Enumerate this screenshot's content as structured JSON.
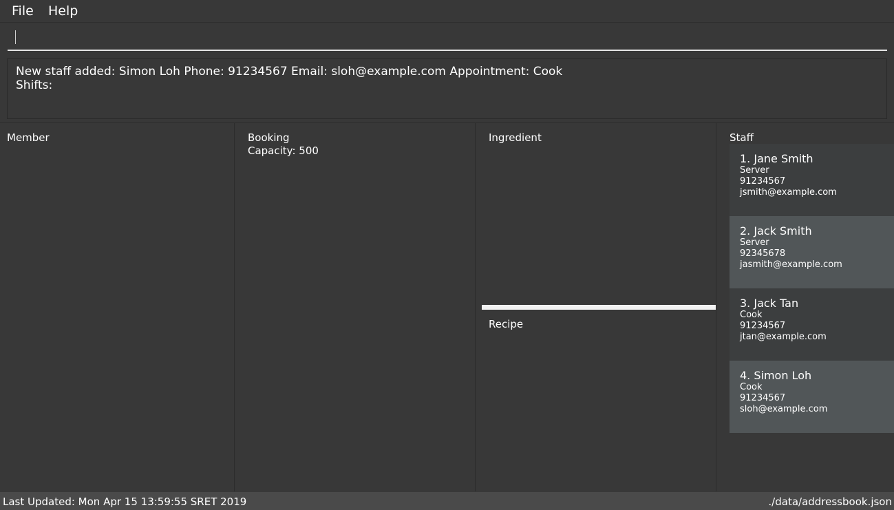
{
  "menu": {
    "file": "File",
    "help": "Help"
  },
  "command": {
    "value": ""
  },
  "result": {
    "text": "New staff added: Simon Loh Phone: 91234567 Email: sloh@example.com Appointment: Cook\nShifts:"
  },
  "panels": {
    "member": {
      "title": "Member"
    },
    "booking": {
      "title": "Booking",
      "capacity": "Capacity: 500"
    },
    "ingredient": {
      "title": "Ingredient"
    },
    "recipe": {
      "title": "Recipe"
    },
    "staff": {
      "title": "Staff"
    }
  },
  "staff": [
    {
      "name": "1.  Jane Smith",
      "appointment": "Server",
      "phone": "91234567",
      "email": "jsmith@example.com"
    },
    {
      "name": "2.  Jack Smith",
      "appointment": "Server",
      "phone": "92345678",
      "email": "jasmith@example.com"
    },
    {
      "name": "3.  Jack Tan",
      "appointment": "Cook",
      "phone": "91234567",
      "email": "jtan@example.com"
    },
    {
      "name": "4.  Simon Loh",
      "appointment": "Cook",
      "phone": "91234567",
      "email": "sloh@example.com"
    }
  ],
  "status": {
    "last_updated": "Last Updated: Mon Apr 15 13:59:55 SRET 2019",
    "file_path": "./data/addressbook.json"
  },
  "colors": {
    "background": "#383838",
    "card_even": "#3c3e3f",
    "card_odd": "#515658",
    "status_bar": "#4a4a4a"
  }
}
